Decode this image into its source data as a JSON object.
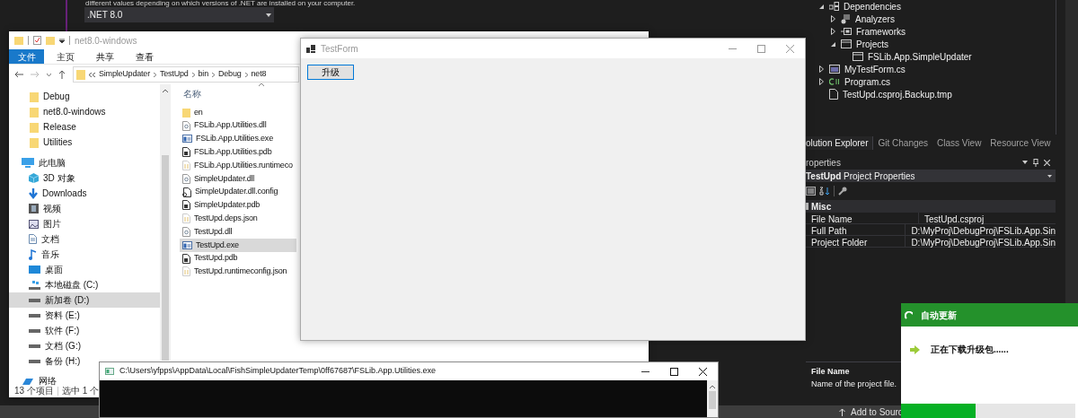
{
  "ide": {
    "hint_text": "different values depending on which versions of .NET are installed on your computer.",
    "framework_dropdown": {
      "value": ".NET 8.0"
    }
  },
  "solution_explorer": {
    "items": [
      {
        "label": "Dependencies",
        "kind": "dependencies",
        "expanded": true,
        "children": [
          {
            "label": "Analyzers",
            "kind": "analyzers",
            "expanded": false
          },
          {
            "label": "Frameworks",
            "kind": "frameworks",
            "expanded": false
          },
          {
            "label": "Projects",
            "kind": "projects",
            "expanded": true,
            "children": [
              {
                "label": "FSLib.App.SimpleUpdater",
                "kind": "projects"
              }
            ]
          }
        ]
      },
      {
        "label": "MyTestForm.cs",
        "kind": "form",
        "expanded": false
      },
      {
        "label": "Program.cs",
        "kind": "csharp",
        "expanded": false
      },
      {
        "label": "TestUpd.csproj.Backup.tmp",
        "kind": "file"
      }
    ]
  },
  "panel_tabs": [
    {
      "label": "olution Explorer",
      "selected": true
    },
    {
      "label": "Git Changes",
      "selected": false
    },
    {
      "label": "Class View",
      "selected": false
    },
    {
      "label": "Resource View",
      "selected": false
    }
  ],
  "properties": {
    "title": "roperties",
    "object_name": "TestUpd",
    "object_type": "Project Properties",
    "category": "Misc",
    "rows": [
      {
        "name": "File Name",
        "value": "TestUpd.csproj"
      },
      {
        "name": "Full Path",
        "value": "D:\\MyProj\\DebugProj\\FSLib.App.Sin"
      },
      {
        "name": "Project Folder",
        "value": "D:\\MyProj\\DebugProj\\FSLib.App.Sin"
      }
    ],
    "description": {
      "title": "File Name",
      "text": "Name of the project file."
    }
  },
  "status_bar": {
    "text": "Add to Sourc"
  },
  "file_explorer": {
    "title": "net8.0-windows",
    "ribbon_tabs": [
      {
        "label": "文件",
        "selected": true
      },
      {
        "label": "主页",
        "selected": false
      },
      {
        "label": "共享",
        "selected": false
      },
      {
        "label": "查看",
        "selected": false
      }
    ],
    "breadcrumb": [
      "SimpleUpdater",
      "TestUpd",
      "bin",
      "Debug",
      "net8"
    ],
    "nav_partial": [
      {
        "label": "Debug",
        "kind": "folder",
        "selected": false
      },
      {
        "label": "net8.0-windows",
        "kind": "folder",
        "selected": false
      },
      {
        "label": "Release",
        "kind": "folder",
        "selected": false
      },
      {
        "label": "Utilities",
        "kind": "folder",
        "selected": false
      }
    ],
    "nav_items": [
      {
        "label": "此电脑",
        "kind": "pc",
        "selected": false,
        "children": [
          {
            "label": "3D 对象",
            "kind": "cube",
            "selected": false
          },
          {
            "label": "Downloads",
            "kind": "download",
            "selected": false
          },
          {
            "label": "视频",
            "kind": "video",
            "selected": false
          },
          {
            "label": "图片",
            "kind": "picture",
            "selected": false
          },
          {
            "label": "文档",
            "kind": "document",
            "selected": false
          },
          {
            "label": "音乐",
            "kind": "music",
            "selected": false
          },
          {
            "label": "桌面",
            "kind": "desktop",
            "selected": false
          },
          {
            "label": "本地磁盘 (C:)",
            "kind": "system_drive",
            "selected": false
          },
          {
            "label": "新加卷 (D:)",
            "kind": "drive",
            "selected": true
          },
          {
            "label": "资料 (E:)",
            "kind": "drive",
            "selected": false
          },
          {
            "label": "软件 (F:)",
            "kind": "drive",
            "selected": false
          },
          {
            "label": "文档 (G:)",
            "kind": "drive",
            "selected": false
          },
          {
            "label": "备份 (H:)",
            "kind": "drive",
            "selected": false
          }
        ]
      },
      {
        "label": "网络",
        "kind": "network",
        "selected": false
      }
    ],
    "column_header": "名称",
    "files": [
      {
        "name": "en",
        "kind": "folder",
        "selected": false
      },
      {
        "name": "FSLib.App.Utilities.dll",
        "kind": "dll",
        "selected": false
      },
      {
        "name": "FSLib.App.Utilities.exe",
        "kind": "exe",
        "selected": false
      },
      {
        "name": "FSLib.App.Utilities.pdb",
        "kind": "pdb",
        "selected": false
      },
      {
        "name": "FSLib.App.Utilities.runtimeco",
        "kind": "json",
        "selected": false
      },
      {
        "name": "SimpleUpdater.dll",
        "kind": "dll",
        "selected": false
      },
      {
        "name": "SimpleUpdater.dll.config",
        "kind": "config",
        "selected": false
      },
      {
        "name": "SimpleUpdater.pdb",
        "kind": "pdb",
        "selected": false
      },
      {
        "name": "TestUpd.deps.json",
        "kind": "json",
        "selected": false
      },
      {
        "name": "TestUpd.dll",
        "kind": "dll",
        "selected": false
      },
      {
        "name": "TestUpd.exe",
        "kind": "exe",
        "selected": true
      },
      {
        "name": "TestUpd.pdb",
        "kind": "pdb",
        "selected": false
      },
      {
        "name": "TestUpd.runtimeconfig.json",
        "kind": "json",
        "selected": false
      }
    ],
    "status": {
      "count": "13 个项目",
      "selection": "选中 1 个"
    }
  },
  "test_form": {
    "title": "TestForm",
    "button": "升级"
  },
  "console": {
    "title": "C:\\Users\\yfpps\\AppData\\Local\\FishSimpleUpdaterTemp\\0ff67687\\FSLib.App.Utilities.exe"
  },
  "updater": {
    "title": "自动更新",
    "message": "正在下载升级包......",
    "level": 0.43
  }
}
